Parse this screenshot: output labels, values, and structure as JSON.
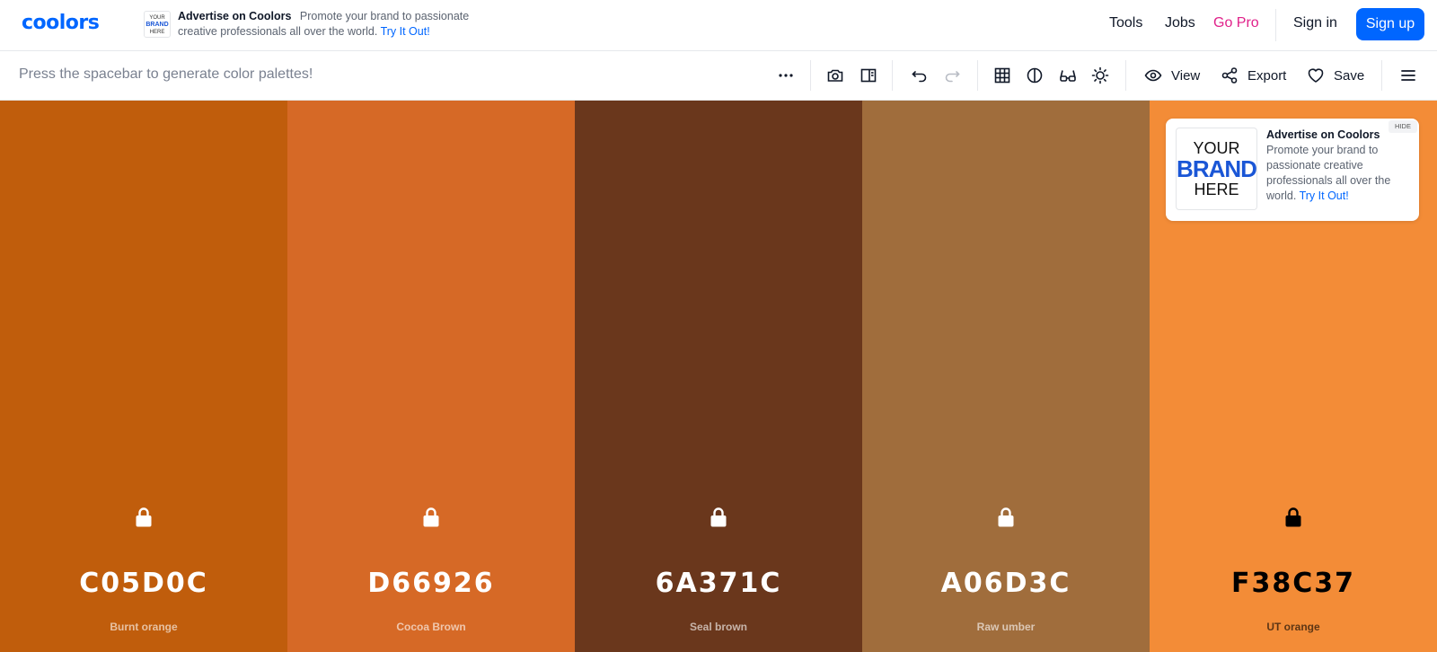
{
  "header": {
    "logo": "coolors",
    "ad": {
      "thumb_line1": "YOUR",
      "thumb_line2": "BRAND",
      "thumb_line3": "HERE",
      "title": "Advertise on Coolors",
      "text": "Promote your brand to passionate creative professionals all over the world.",
      "link": "Try It Out!"
    },
    "nav": {
      "tools": "Tools",
      "jobs": "Jobs",
      "gopro": "Go Pro",
      "signin": "Sign in",
      "signup": "Sign up"
    }
  },
  "toolbar": {
    "hint": "Press the spacebar to generate color palettes!",
    "icons": [
      "more-options-icon",
      "camera-icon",
      "side-panel-icon",
      "undo-icon",
      "redo-icon",
      "grid-icon",
      "contrast-icon",
      "glasses-icon",
      "brightness-icon",
      "eye-icon",
      "share-icon",
      "heart-icon",
      "hamburger-menu-icon"
    ],
    "view": "View",
    "export": "Export",
    "save": "Save"
  },
  "palette": [
    {
      "hex": "C05D0C",
      "name": "Burnt orange",
      "color": "#C05D0C",
      "text_color": "#ffffff",
      "locked": false
    },
    {
      "hex": "D66926",
      "name": "Cocoa Brown",
      "color": "#D66926",
      "text_color": "#ffffff",
      "locked": false
    },
    {
      "hex": "6A371C",
      "name": "Seal brown",
      "color": "#6A371C",
      "text_color": "#ffffff",
      "locked": false
    },
    {
      "hex": "A06D3C",
      "name": "Raw umber",
      "color": "#A06D3C",
      "text_color": "#ffffff",
      "locked": false
    },
    {
      "hex": "F38C37",
      "name": "UT orange",
      "color": "#F38C37",
      "text_color": "#000000",
      "locked": true
    }
  ],
  "ad_card": {
    "hide": "HIDE",
    "img_line1": "YOUR",
    "img_line2": "BRAND",
    "img_line3": "HERE",
    "title": "Advertise on Coolors",
    "text": "Promote your brand to passionate creative professionals all over the world.",
    "link": "Try It Out!"
  },
  "colors": {
    "accent": "#0066ff",
    "pro": "#e0218a"
  }
}
